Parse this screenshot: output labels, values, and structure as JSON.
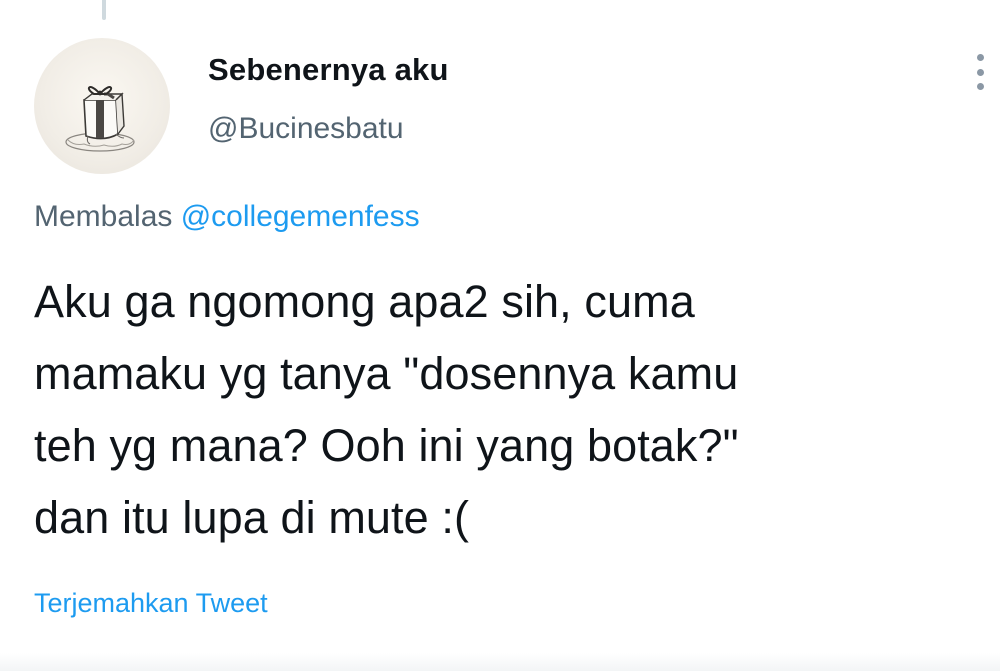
{
  "tweet": {
    "display_name": "Sebenernya aku",
    "handle": "@Bucinesbatu",
    "reply_prefix": "Membalas ",
    "reply_mention": "@collegemenfess",
    "text": "Aku ga ngomong apa2 sih, cuma\nmamaku yg tanya \"dosennya kamu\nteh yg mana? Ooh ini yang botak?\"\ndan itu lupa di mute :(",
    "translate_label": "Terjemahkan Tweet"
  },
  "icons": {
    "more": "more-vertical-icon",
    "avatar": "melting-ice-cube-gift-illustration"
  },
  "colors": {
    "text_primary": "#0f1419",
    "text_secondary": "#536471",
    "link": "#1d9bf0",
    "thread_line": "#cfd9de"
  }
}
